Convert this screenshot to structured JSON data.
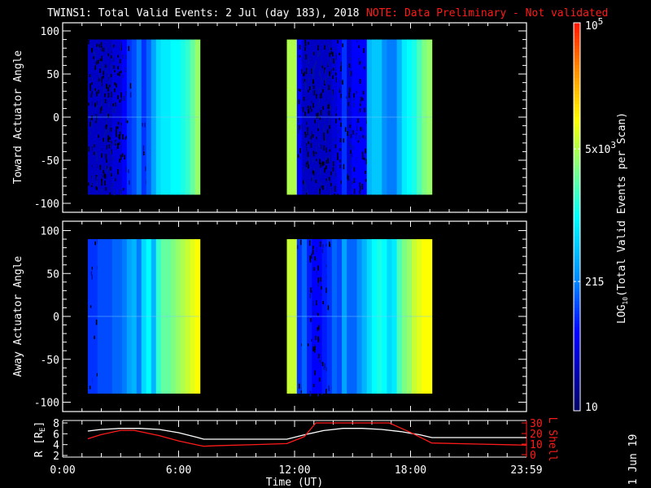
{
  "title": "TWINS1: Total Valid Events:  2 Jul (day 183), 2018",
  "note": "NOTE: Data Preliminary - Not validated",
  "footer_date": "1 Jun 19",
  "colors": {
    "background": "#000000",
    "axis": "#ffffff",
    "note": "#ff1a1a",
    "lshell": "#ff1a1a",
    "radius": "#ffffff"
  },
  "chart_data": [
    {
      "type": "heatmap",
      "id": "toward",
      "ylabel": "Toward Actuator Angle",
      "ylim": [
        -110,
        110
      ],
      "yticks": [
        "100",
        "50",
        "0",
        "-50",
        "-100"
      ],
      "ytick_values": [
        100,
        50,
        0,
        -50,
        -100
      ],
      "xlim_hours": [
        0,
        24
      ],
      "angle_range": [
        -90,
        90
      ],
      "blocks": [
        {
          "start_hour": 1.3,
          "end_hour": 7.1,
          "log10_counts": [
            1.5,
            1.5,
            1.5,
            1.5,
            1.5,
            1.6,
            1.6,
            1.8,
            2.0,
            2.1,
            2.3,
            2.0,
            2.2,
            2.5,
            2.8,
            2.9,
            2.9,
            3.0,
            3.0,
            3.1,
            3.2,
            3.4,
            3.6
          ]
        },
        {
          "start_hour": 11.6,
          "end_hour": 19.1,
          "log10_counts": [
            3.7,
            3.7,
            1.8,
            1.5,
            1.5,
            1.5,
            1.5,
            1.5,
            1.5,
            1.6,
            1.7,
            2.0,
            1.6,
            1.8,
            1.8,
            1.8,
            2.6,
            2.7,
            2.7,
            2.4,
            2.3,
            2.3,
            2.6,
            2.9,
            3.0,
            3.1,
            3.3,
            3.5,
            3.6
          ]
        }
      ]
    },
    {
      "type": "heatmap",
      "id": "away",
      "ylabel": "Away Actuator Angle",
      "ylim": [
        -110,
        110
      ],
      "yticks": [
        "100",
        "50",
        "0",
        "-50",
        "-100"
      ],
      "ytick_values": [
        100,
        50,
        0,
        -50,
        -100
      ],
      "xlim_hours": [
        0,
        24
      ],
      "angle_range": [
        -90,
        90
      ],
      "blocks": [
        {
          "start_hour": 1.3,
          "end_hour": 7.1,
          "log10_counts": [
            2.0,
            2.0,
            2.1,
            2.1,
            2.1,
            2.2,
            2.2,
            2.3,
            2.5,
            2.6,
            2.3,
            2.8,
            3.0,
            2.6,
            3.2,
            3.4,
            3.4,
            3.5,
            3.6,
            3.7,
            3.8,
            3.9,
            4.0
          ]
        },
        {
          "start_hour": 11.6,
          "end_hour": 19.1,
          "log10_counts": [
            3.8,
            3.8,
            2.0,
            2.2,
            1.9,
            1.8,
            1.8,
            1.9,
            2.0,
            2.2,
            2.1,
            2.5,
            2.2,
            2.2,
            2.4,
            2.6,
            2.8,
            3.0,
            3.1,
            3.0,
            2.8,
            2.9,
            3.3,
            3.5,
            3.6,
            3.8,
            3.9,
            4.0,
            4.0
          ]
        }
      ]
    },
    {
      "type": "line",
      "id": "orbit",
      "ylabel": "R [RE]",
      "ylabel_main": "R [R",
      "ylabel_sub": "E",
      "ylabel_end": "]",
      "y2label": "L Shell",
      "ylim": [
        2,
        8
      ],
      "y2lim": [
        0,
        30
      ],
      "yticks": [
        "8",
        "6",
        "4",
        "2"
      ],
      "ytick_values": [
        8,
        6,
        4,
        2
      ],
      "y2ticks": [
        "30",
        "20",
        "10",
        "0"
      ],
      "y2tick_values": [
        30,
        20,
        10,
        0
      ],
      "xlabel": "Time (UT)",
      "xticks": [
        "0:00",
        "6:00",
        "12:00",
        "18:00",
        "23:59"
      ],
      "xtick_values": [
        0,
        6,
        12,
        18,
        24
      ],
      "series": [
        {
          "name": "R",
          "axis": "left",
          "x": [
            1.3,
            2,
            3,
            4,
            5,
            6,
            7,
            7.3,
            9,
            11.6,
            12.5,
            13.5,
            14.5,
            15.5,
            16.5,
            17.5,
            18.5,
            19.1,
            21,
            24
          ],
          "y": [
            6.5,
            6.8,
            7.0,
            7.0,
            6.8,
            6.2,
            5.3,
            5.0,
            5.0,
            5.0,
            5.8,
            6.6,
            7.0,
            7.0,
            6.8,
            6.4,
            5.8,
            5.3,
            5.3,
            5.3
          ]
        },
        {
          "name": "L Shell",
          "axis": "right",
          "x": [
            1.3,
            2,
            3,
            3.7,
            5,
            6,
            7,
            7.3,
            8,
            10,
            11.6,
            12.5,
            13.1,
            16.9,
            18,
            19.1,
            21.5,
            24
          ],
          "y": [
            15,
            19,
            23,
            23,
            18,
            13,
            9,
            8,
            8.5,
            9.5,
            10.5,
            17,
            30,
            30,
            21,
            11,
            10,
            9
          ]
        }
      ]
    }
  ],
  "colorbar": {
    "label_prefix": "LOG",
    "label_sub": "10",
    "label_rest": "(Total Valid Events per Scan)",
    "scale": "log",
    "range": [
      10,
      100000
    ],
    "ticks": [
      {
        "value": 100000,
        "base": "10",
        "exp": "5",
        "label": "10^5"
      },
      {
        "value": 5000,
        "base": "5x10",
        "exp": "3",
        "label": "5x10^3"
      },
      {
        "value": 215,
        "base": "215",
        "exp": "",
        "label": "215"
      },
      {
        "value": 10,
        "base": "10",
        "exp": "",
        "label": "10"
      }
    ]
  }
}
